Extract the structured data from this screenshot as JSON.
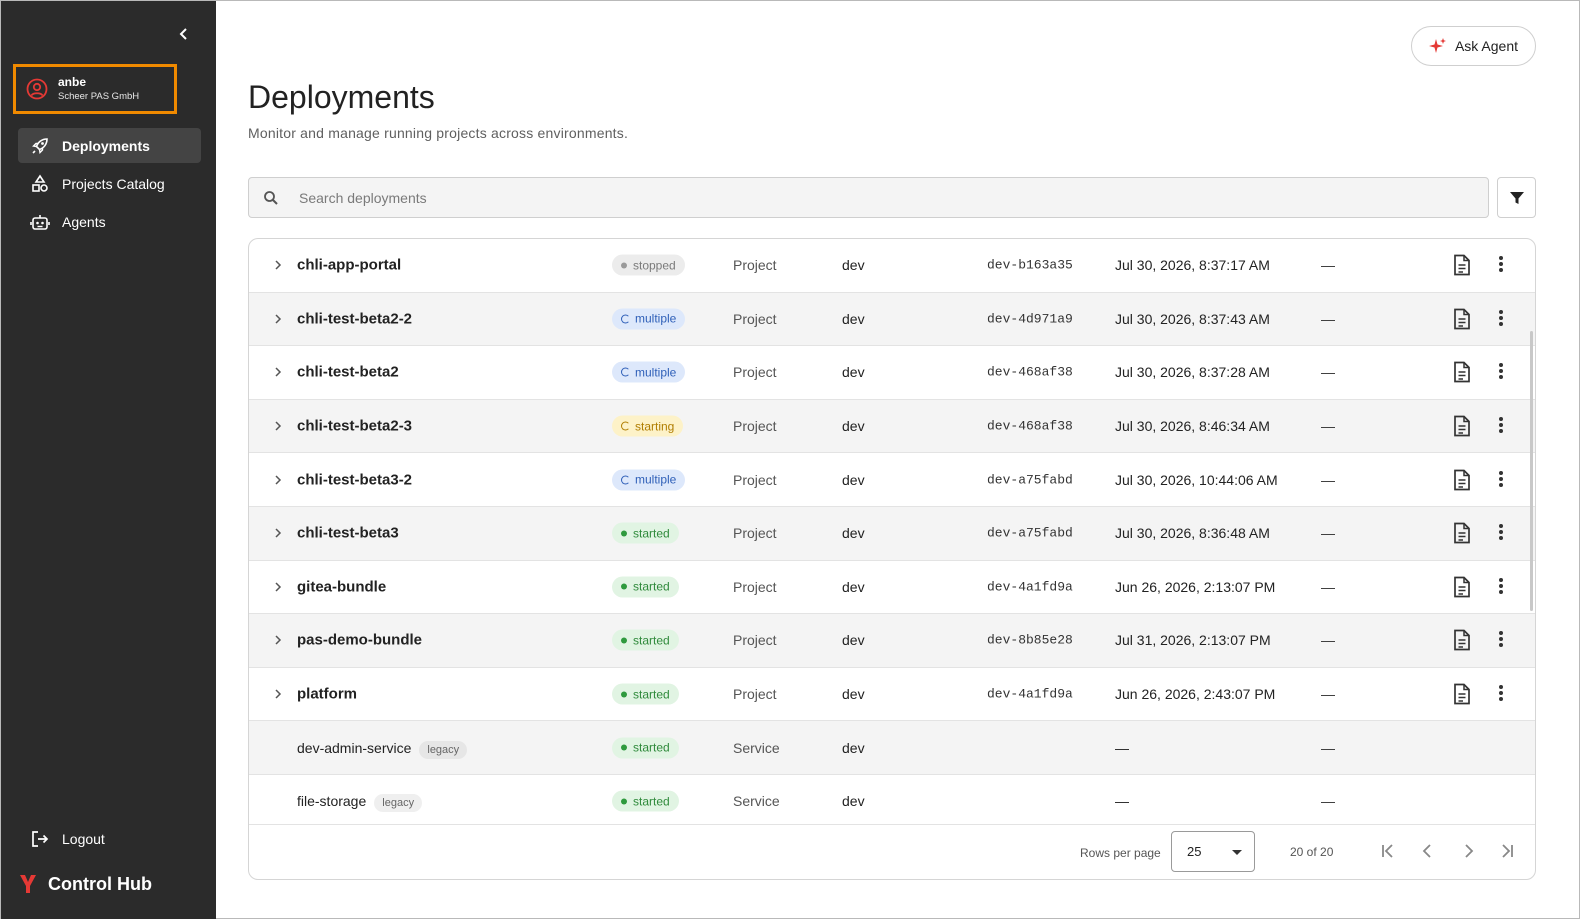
{
  "sidebar": {
    "user": {
      "name": "anbe",
      "org": "Scheer PAS GmbH"
    },
    "nav": [
      {
        "label": "Deployments",
        "icon": "rocket-icon",
        "active": true
      },
      {
        "label": "Projects Catalog",
        "icon": "shapes-icon",
        "active": false
      },
      {
        "label": "Agents",
        "icon": "robot-icon",
        "active": false
      }
    ],
    "logout_label": "Logout",
    "brand": "Control Hub"
  },
  "header": {
    "ask_agent_label": "Ask Agent",
    "title": "Deployments",
    "subtitle": "Monitor and manage running projects across environments."
  },
  "search": {
    "placeholder": "Search deployments",
    "value": ""
  },
  "table": {
    "rows": [
      {
        "name": "chli-app-portal",
        "legacy": "",
        "status": "stopped",
        "type": "Project",
        "env": "dev",
        "hash": "dev-b163a35",
        "date": "Jul 30, 2026, 8:37:17 AM",
        "extra": "—",
        "expandable": true
      },
      {
        "name": "chli-test-beta2-2",
        "legacy": "",
        "status": "multiple",
        "type": "Project",
        "env": "dev",
        "hash": "dev-4d971a9",
        "date": "Jul 30, 2026, 8:37:43 AM",
        "extra": "—",
        "expandable": true
      },
      {
        "name": "chli-test-beta2",
        "legacy": "",
        "status": "multiple",
        "type": "Project",
        "env": "dev",
        "hash": "dev-468af38",
        "date": "Jul 30, 2026, 8:37:28 AM",
        "extra": "—",
        "expandable": true
      },
      {
        "name": "chli-test-beta2-3",
        "legacy": "",
        "status": "starting",
        "type": "Project",
        "env": "dev",
        "hash": "dev-468af38",
        "date": "Jul 30, 2026, 8:46:34 AM",
        "extra": "—",
        "expandable": true
      },
      {
        "name": "chli-test-beta3-2",
        "legacy": "",
        "status": "multiple",
        "type": "Project",
        "env": "dev",
        "hash": "dev-a75fabd",
        "date": "Jul 30, 2026, 10:44:06 AM",
        "extra": "—",
        "expandable": true
      },
      {
        "name": "chli-test-beta3",
        "legacy": "",
        "status": "started",
        "type": "Project",
        "env": "dev",
        "hash": "dev-a75fabd",
        "date": "Jul 30, 2026, 8:36:48 AM",
        "extra": "—",
        "expandable": true
      },
      {
        "name": "gitea-bundle",
        "legacy": "",
        "status": "started",
        "type": "Project",
        "env": "dev",
        "hash": "dev-4a1fd9a",
        "date": "Jun 26, 2026, 2:13:07 PM",
        "extra": "—",
        "expandable": true
      },
      {
        "name": "pas-demo-bundle",
        "legacy": "",
        "status": "started",
        "type": "Project",
        "env": "dev",
        "hash": "dev-8b85e28",
        "date": "Jul 31, 2026, 2:13:07 PM",
        "extra": "—",
        "expandable": true
      },
      {
        "name": "platform",
        "legacy": "",
        "status": "started",
        "type": "Project",
        "env": "dev",
        "hash": "dev-4a1fd9a",
        "date": "Jun 26, 2026, 2:43:07 PM",
        "extra": "—",
        "expandable": true
      },
      {
        "name": "dev-admin-service",
        "legacy": "legacy",
        "status": "started",
        "type": "Service",
        "env": "dev",
        "hash": "",
        "date": "—",
        "extra": "—",
        "expandable": false
      },
      {
        "name": "file-storage",
        "legacy": "legacy",
        "status": "started",
        "type": "Service",
        "env": "dev",
        "hash": "",
        "date": "—",
        "extra": "—",
        "expandable": false
      }
    ]
  },
  "pagination": {
    "rows_per_page_label": "Rows per page",
    "rows_per_page": "25",
    "range": "20 of 20"
  },
  "colors": {
    "sidebar_bg": "#2b2b2b",
    "highlight_border": "#f08a00",
    "brand_red": "#e53935"
  }
}
